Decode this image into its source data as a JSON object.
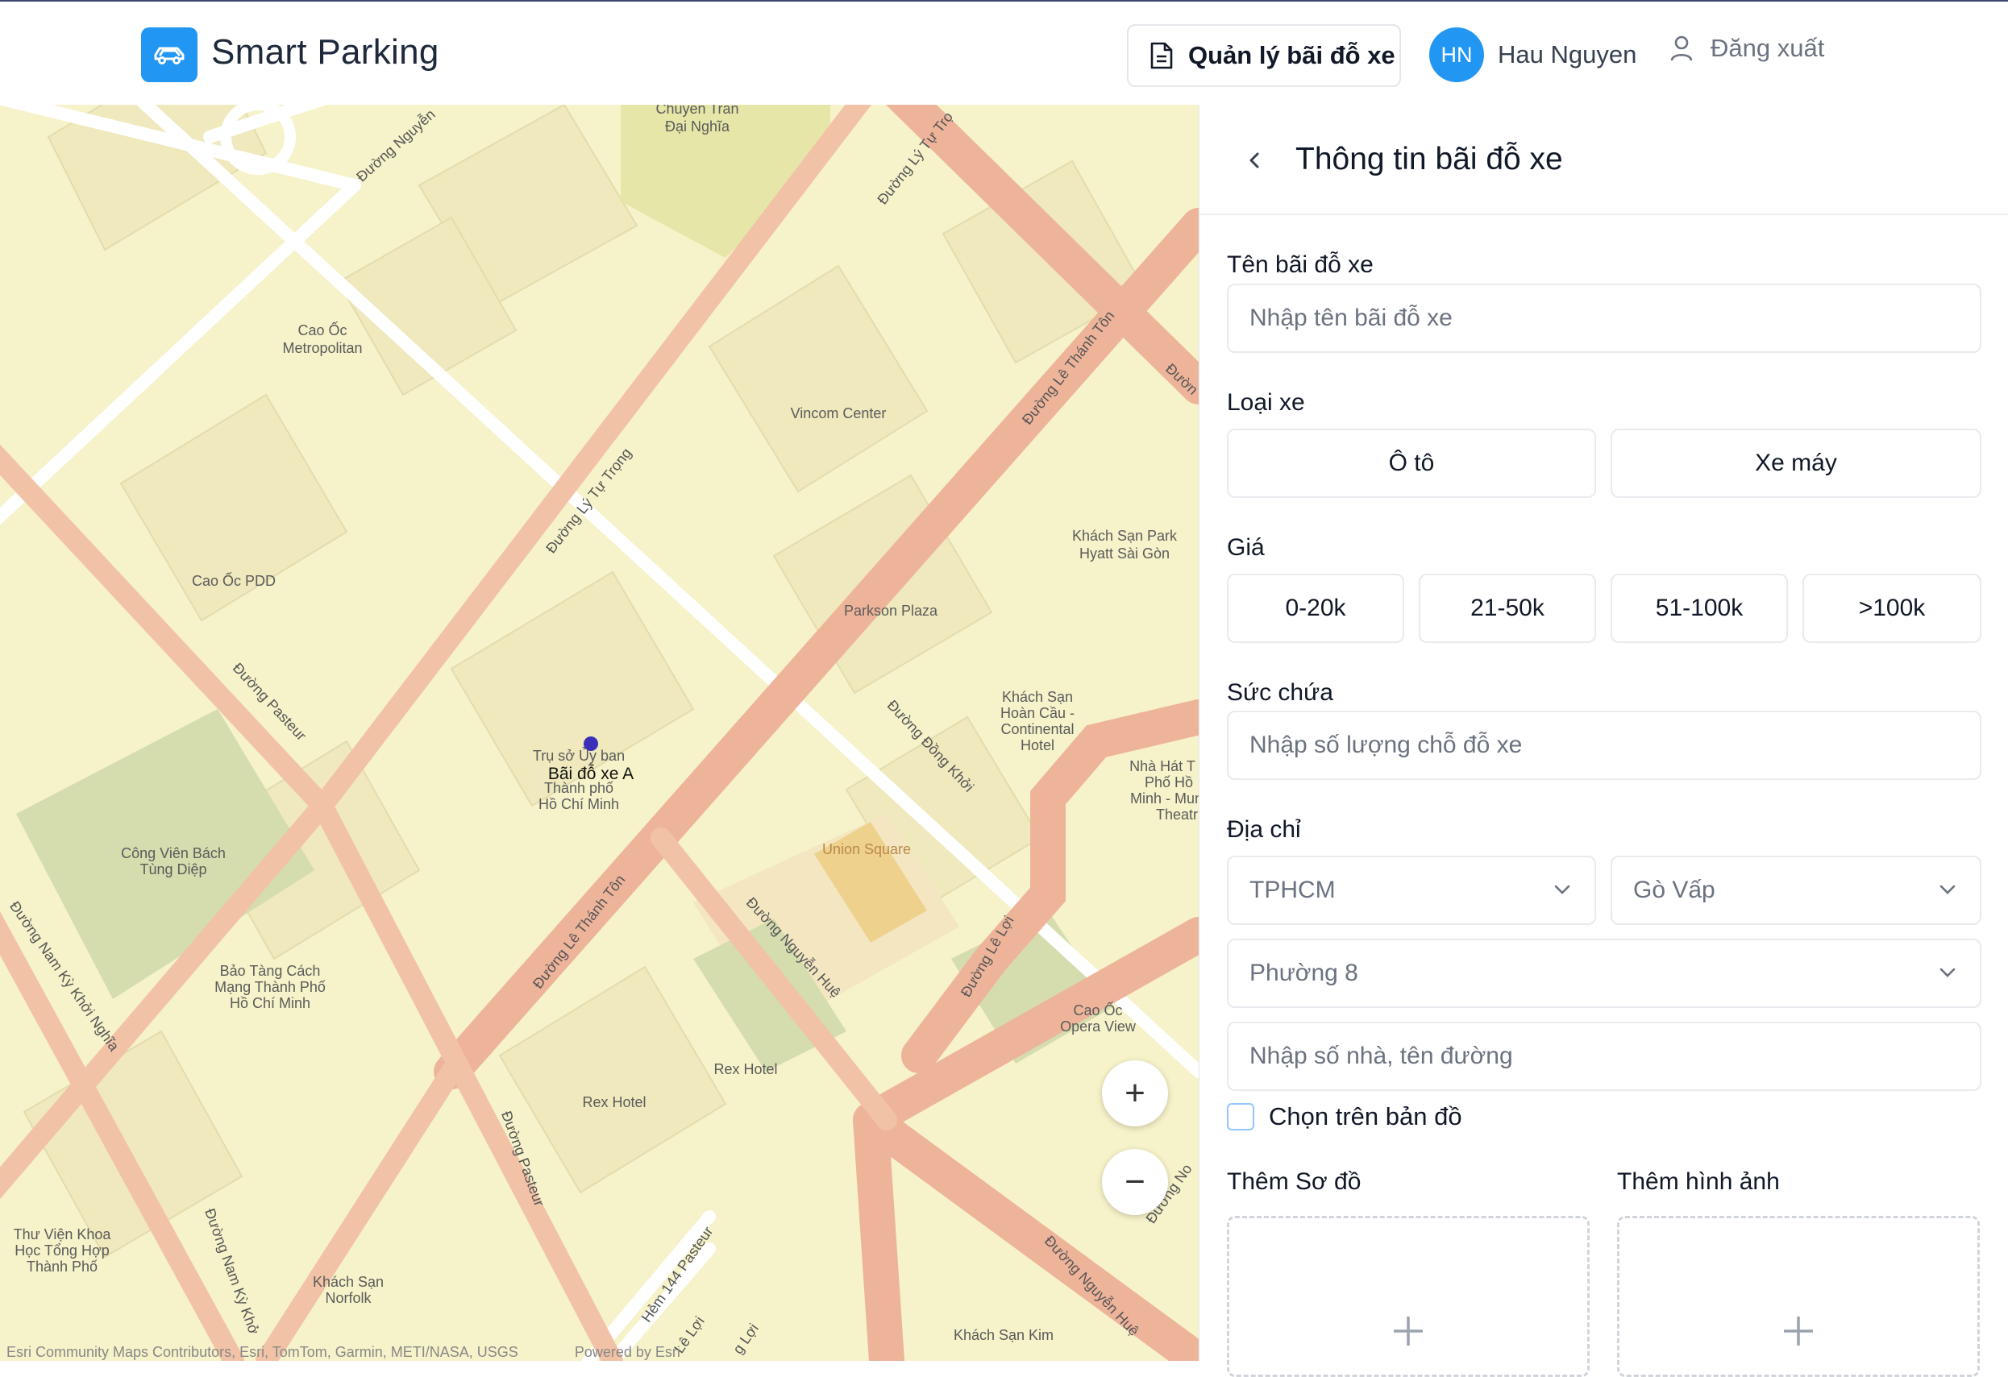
{
  "header": {
    "brand": "Smart Parking",
    "manage_label": "Quản lý bãi đỗ xe",
    "avatar_initials": "HN",
    "user_name": "Hau Nguyen",
    "logout_label": "Đăng xuất",
    "accent_color": "#2196f3"
  },
  "map": {
    "marker_label": "Bãi đỗ xe A",
    "zoom_in": "+",
    "zoom_out": "−",
    "attribution": "Esri Community Maps Contributors, Esri, TomTom, Garmin, METI/NASA, USGS",
    "powered_by": "Powered by Esri",
    "place_labels": {
      "chuyen_tran": "Chuyên Trần",
      "dai_nghia": "Đại Nghĩa",
      "cao_oc_metro_1": "Cao Ốc",
      "cao_oc_metro_2": "Metropolitan",
      "vincom": "Vincom Center",
      "cao_oc_pdd": "Cao Ốc PDD",
      "hyatt_1": "Khách Sạn Park",
      "hyatt_2": "Hyatt Sài Gòn",
      "parkson": "Parkson Plaza",
      "hoan_cau_1": "Khách Sạn",
      "hoan_cau_2": "Hoàn Cầu -",
      "hoan_cau_3": "Continental",
      "hoan_cau_4": "Hotel",
      "nha_hat_1": "Nhà Hát T",
      "nha_hat_2": "Phố Hồ",
      "nha_hat_3": "Minh - Mun",
      "nha_hat_4": "Theatr",
      "tru_so_1": "Trụ sở Ủy ban",
      "tru_so_2": "Thành phố",
      "tru_so_3": "Hồ Chí Minh",
      "cong_vien_1": "Công Viên Bách",
      "cong_vien_2": "Tùng Diệp",
      "union": "Union Square",
      "bao_tang_1": "Bảo Tàng Cách",
      "bao_tang_2": "Mạng Thành Phố",
      "bao_tang_3": "Hồ Chí Minh",
      "opera_1": "Cao Ốc",
      "opera_2": "Opera View",
      "rex_1": "Rex Hotel",
      "rex_2": "Rex Hotel",
      "thu_vien_1": "Thư Viện Khoa",
      "thu_vien_2": "Học Tổng Hợp",
      "thu_vien_3": "Thành Phố",
      "norfolk_1": "Khách Sạn",
      "norfolk_2": "Norfolk",
      "kim_do": "Khách Sạn Kim"
    },
    "road_labels": {
      "nguyen_top": "Đường Nguyễn",
      "ly_tu_trong_top": "Đường Lý Tự Trọ",
      "le_thanh_ton_right": "Đường Lê Thánh Tôn",
      "duong_edge": "Đườn",
      "ly_tu_trong": "Đường Lý Tự Trọng",
      "pasteur_left": "Đường Pasteur",
      "dong_khoi": "Đường Đồng Khởi",
      "le_thanh_ton": "Đường Lê Thánh Tôn",
      "nguyen_hue": "Đường Nguyễn Huệ",
      "le_loi": "Đường Lê Lợi",
      "nam_ky": "Đường Nam Kỳ Khởi Nghĩa",
      "pasteur": "Đường Pasteur",
      "nam_ky_bottom": "Đường Nam Kỳ Khở",
      "hem_144": "Hẻm 144 Pasteur",
      "le_loi_bottom": "Lê Lợi",
      "loi_bottom": "g Lợi",
      "nguyen_hue_bottom": "Đường Nguyễn Huệ",
      "duong_no": "Đường No"
    }
  },
  "panel": {
    "title": "Thông tin bãi đỗ xe",
    "name_label": "Tên bãi đỗ xe",
    "name_placeholder": "Nhập tên bãi đỗ xe",
    "vehicle_label": "Loại xe",
    "vehicle_options": [
      "Ô tô",
      "Xe máy"
    ],
    "price_label": "Giá",
    "price_options": [
      "0-20k",
      "21-50k",
      "51-100k",
      ">100k"
    ],
    "capacity_label": "Sức chứa",
    "capacity_placeholder": "Nhập số lượng chỗ đỗ xe",
    "address_label": "Địa chỉ",
    "city": "TPHCM",
    "district": "Gò Vấp",
    "ward": "Phường 8",
    "street_placeholder": "Nhập số nhà, tên đường",
    "pick_on_map_label": "Chọn trên bản đồ",
    "add_diagram_label": "Thêm Sơ đồ",
    "add_image_label": "Thêm hình ảnh"
  }
}
